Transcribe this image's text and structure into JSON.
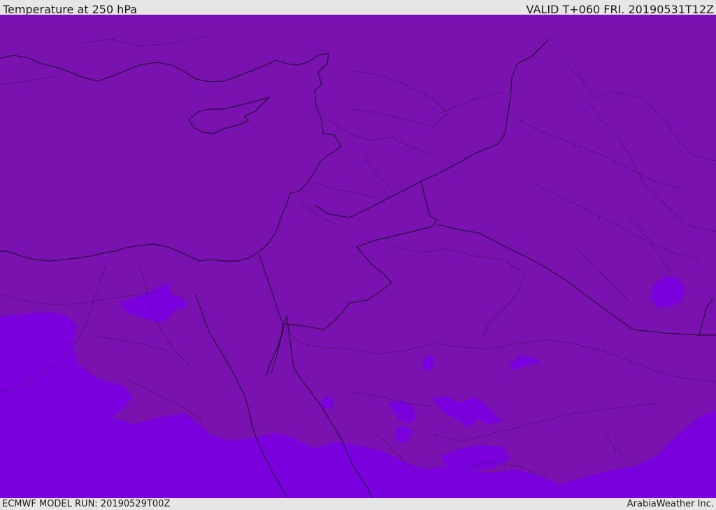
{
  "header": {
    "title": "Temperature at 250 hPa",
    "valid_time": "VALID T+060 FRI. 20190531T12Z"
  },
  "footer": {
    "model_run": "ECMWF MODEL RUN: 20190529T00Z",
    "credit": "ArabiaWeather Inc."
  },
  "map": {
    "field_colors": {
      "base": "#7a12b0",
      "cold_band": "#7a00dd",
      "border_lines": "#1a0030"
    }
  }
}
